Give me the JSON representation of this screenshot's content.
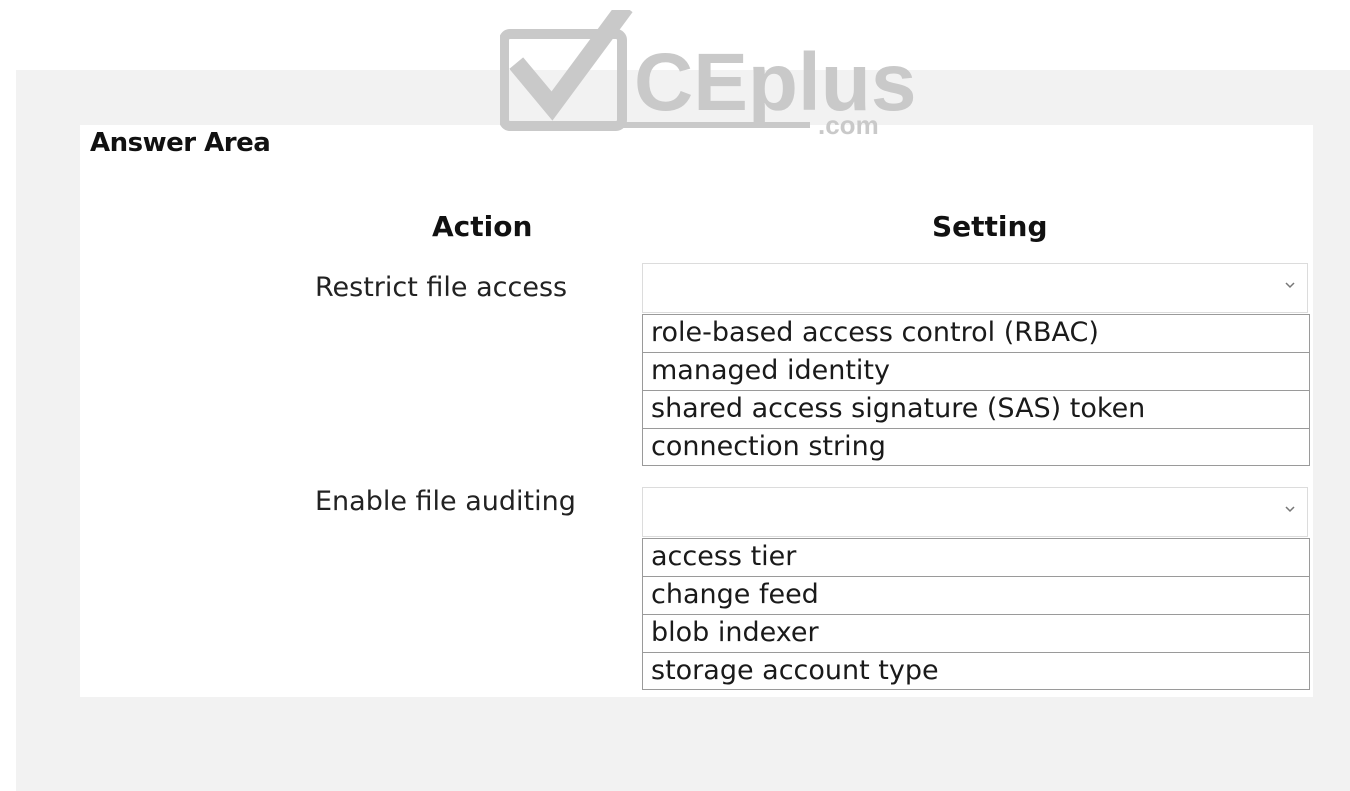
{
  "watermark": {
    "brand": "CEplus",
    "suffix": ".com"
  },
  "answer_area": {
    "title": "Answer Area"
  },
  "columns": {
    "action": "Action",
    "setting": "Setting"
  },
  "rows": [
    {
      "action": "Restrict file access",
      "selected": "",
      "options": [
        "role-based access control (RBAC)",
        "managed identity",
        "shared access signature (SAS) token",
        "connection string"
      ]
    },
    {
      "action": "Enable file auditing",
      "selected": "",
      "options": [
        "access tier",
        "change feed",
        "blob indexer",
        "storage account type"
      ]
    }
  ],
  "icons": {
    "dropdown": "chevron-down-icon",
    "logo": "checkmark-logo-icon"
  },
  "colors": {
    "panel": "#f2f2f2",
    "card": "#ffffff",
    "border": "#9a9a9a",
    "logo": "#c9c9c9"
  }
}
